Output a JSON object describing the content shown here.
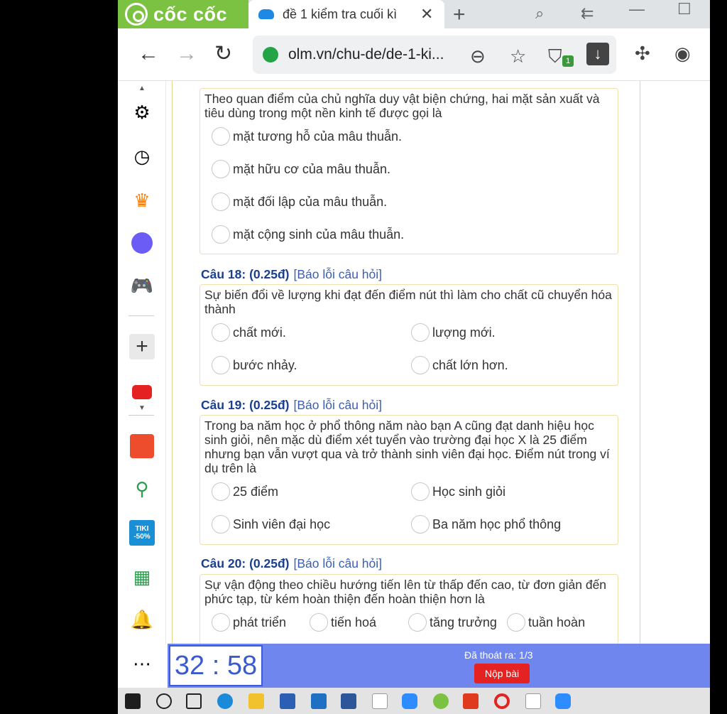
{
  "browser": {
    "brand": "cốc cốc",
    "tab_title": "đề 1 kiểm tra cuối kì",
    "url": "olm.vn/chu-de/de-1-ki...",
    "shield_badge": "1"
  },
  "questions": [
    {
      "text": "Theo quan điểm của chủ nghĩa duy vật biện chứng, hai mặt sản xuất và tiêu dùng trong một nền kinh tế được gọi là",
      "options": [
        "mặt tương hỗ của mâu thuẫn.",
        "mặt hữu cơ của mâu thuẫn.",
        "mặt đối lập của mâu thuẫn.",
        "mặt cộng sinh của mâu thuẫn."
      ]
    },
    {
      "label": "Câu 18: (0.25đ)",
      "report": "[Báo lỗi câu hỏi]",
      "text": "Sự biến đổi về lượng khi đạt đến điểm nút thì làm cho chất cũ chuyển hóa thành",
      "options": [
        "chất mới.",
        "lượng mới.",
        "bước nhảy.",
        "chất lớn hơn."
      ]
    },
    {
      "label": "Câu 19: (0.25đ)",
      "report": "[Báo lỗi câu hỏi]",
      "text": "Trong ba năm học ở phổ thông năm nào bạn A cũng đạt danh hiệu học sinh giỏi, nên mặc dù điểm xét tuyển vào trường đại học X là 25 điểm nhưng bạn vẫn vượt qua và trở thành sinh viên đại học. Điểm nút trong ví dụ trên là",
      "options": [
        "25 điểm",
        "Học sinh giỏi",
        "Sinh viên đại học",
        "Ba năm học phổ thông"
      ]
    },
    {
      "label": "Câu 20: (0.25đ)",
      "report": "[Báo lỗi câu hỏi]",
      "text": "Sự vận động theo chiều hướng tiến lên từ thấp đến cao, từ đơn giản đến phức tạp, từ kém hoàn thiện đến hoàn thiện hơn là",
      "options": [
        "phát triển",
        "tiến hoá",
        "tăng trưởng",
        "tuần hoàn"
      ]
    }
  ],
  "footer": {
    "timer": "32 : 58",
    "exit_count": "Đã thoát ra: 1/3",
    "submit": "Nộp bài"
  },
  "sidebar_icons": [
    "gear-icon",
    "history-icon",
    "crown-icon",
    "messenger-icon",
    "gamepad-icon",
    "add-icon",
    "youtube-icon",
    "shopee-icon",
    "game-icon",
    "tiki-icon",
    "spreadsheet-icon",
    "bell-icon",
    "more-icon"
  ],
  "tiki_label": "TIKI",
  "tiki_discount": "-50%",
  "colors": {
    "brand": "#7cc242",
    "timer_bar": "#6f86ee",
    "submit": "#e52222",
    "question_label": "#1a3f8f"
  }
}
